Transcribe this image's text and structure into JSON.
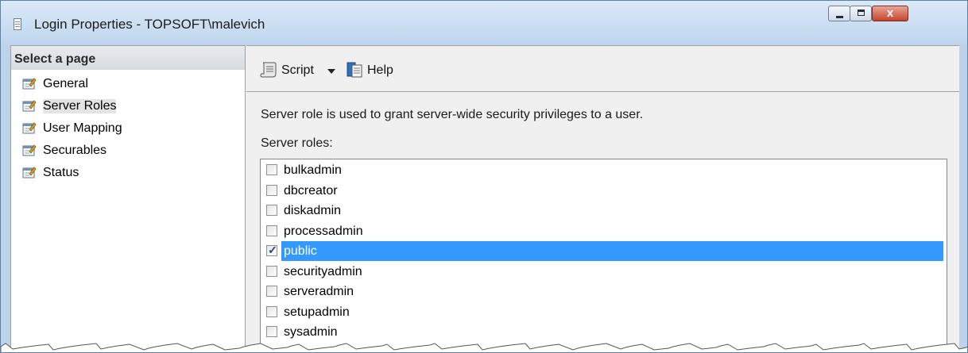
{
  "window": {
    "title": "Login Properties - TOPSOFT\\malevich",
    "close_glyph": "x",
    "accent_color": "#3399ff"
  },
  "left_pane": {
    "header": "Select a page",
    "items": [
      {
        "label": "General",
        "icon": "page-wrench-icon",
        "selected": false
      },
      {
        "label": "Server Roles",
        "icon": "page-wrench-icon",
        "selected": true
      },
      {
        "label": "User Mapping",
        "icon": "page-wrench-icon",
        "selected": false
      },
      {
        "label": "Securables",
        "icon": "page-wrench-icon",
        "selected": false
      },
      {
        "label": "Status",
        "icon": "page-wrench-icon",
        "selected": false
      }
    ]
  },
  "toolbar": {
    "script_label": "Script",
    "help_label": "Help",
    "script_icon": "script-icon",
    "help_icon": "help-icon"
  },
  "main": {
    "description": "Server role is used to grant server-wide security privileges to a user.",
    "roles_label": "Server roles:",
    "roles": [
      {
        "name": "bulkadmin",
        "checked": false
      },
      {
        "name": "dbcreator",
        "checked": false
      },
      {
        "name": "diskadmin",
        "checked": false
      },
      {
        "name": "processadmin",
        "checked": false
      },
      {
        "name": "public",
        "checked": true
      },
      {
        "name": "securityadmin",
        "checked": false
      },
      {
        "name": "serveradmin",
        "checked": false
      },
      {
        "name": "setupadmin",
        "checked": false
      },
      {
        "name": "sysadmin",
        "checked": false
      }
    ]
  }
}
